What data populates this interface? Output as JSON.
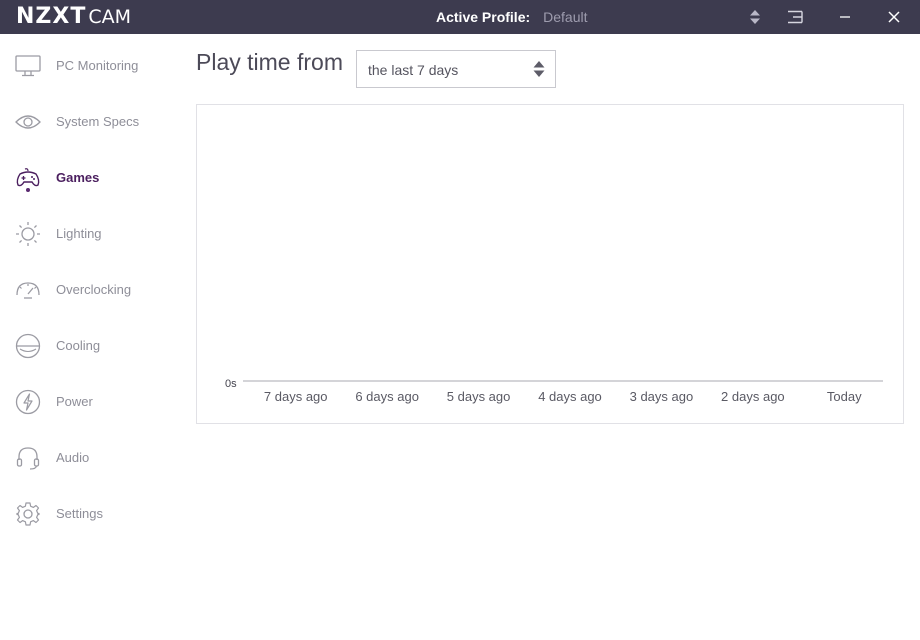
{
  "app": {
    "logo_main": "NZXT",
    "logo_sub": "CAM",
    "profile_label": "Active Profile:",
    "profile_value": "Default"
  },
  "titlebar_icons": [
    "sort-arrows-icon",
    "menu-lines-icon",
    "minimize-icon",
    "close-icon"
  ],
  "sidebar": {
    "items": [
      {
        "label": "PC Monitoring",
        "icon": "monitor-icon",
        "active": false
      },
      {
        "label": "System Specs",
        "icon": "eye-icon",
        "active": false
      },
      {
        "label": "Games",
        "icon": "gamepad-icon",
        "active": true
      },
      {
        "label": "Lighting",
        "icon": "sun-icon",
        "active": false
      },
      {
        "label": "Overclocking",
        "icon": "speedometer-icon",
        "active": false
      },
      {
        "label": "Cooling",
        "icon": "cooling-circle-icon",
        "active": false
      },
      {
        "label": "Power",
        "icon": "lightning-bolt-icon",
        "active": false
      },
      {
        "label": "Audio",
        "icon": "headset-icon",
        "active": false
      },
      {
        "label": "Settings",
        "icon": "gear-icon",
        "active": false
      }
    ]
  },
  "main": {
    "title": "Play time from",
    "range_select": {
      "value": "the last 7 days"
    }
  },
  "colors": {
    "titlebar_bg": "#3d3b4f",
    "accent": "#4b1f5f",
    "nav_text": "#8e8e98"
  },
  "chart_data": {
    "type": "bar",
    "categories": [
      "7 days ago",
      "6 days ago",
      "5 days ago",
      "4 days ago",
      "3 days ago",
      "2 days ago",
      "Today"
    ],
    "values": [
      0,
      0,
      0,
      0,
      0,
      0,
      0
    ],
    "y_tick_labels": [
      "0s"
    ],
    "title": "",
    "xlabel": "",
    "ylabel": "",
    "grid": false,
    "legend": "none"
  }
}
